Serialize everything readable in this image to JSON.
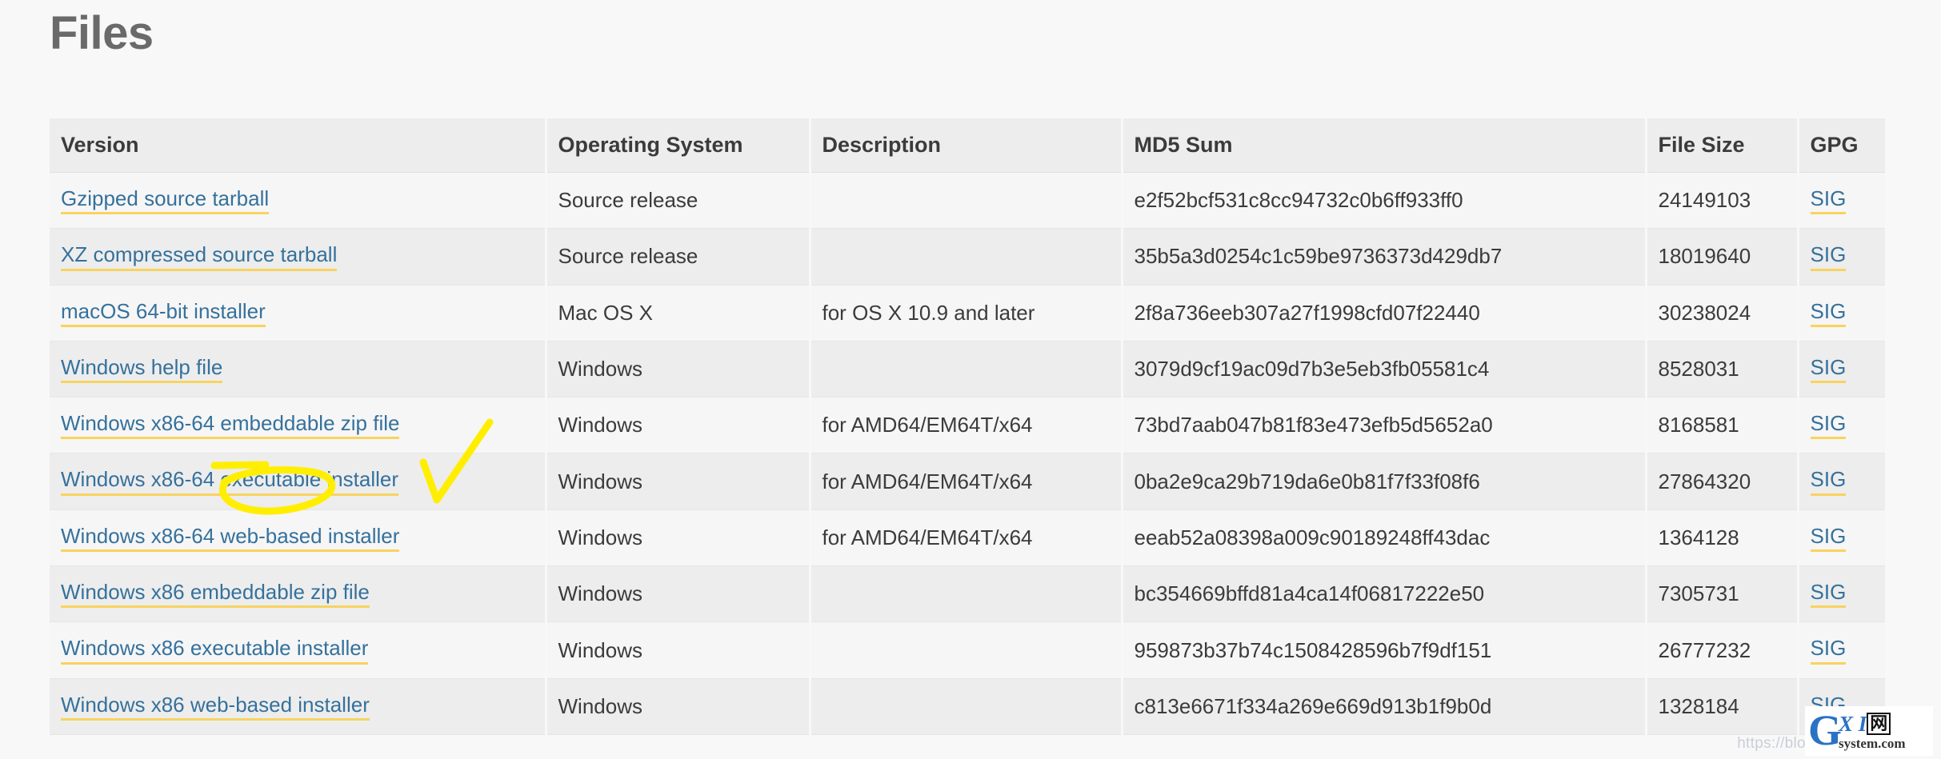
{
  "page": {
    "title": "Files"
  },
  "table": {
    "columns": [
      {
        "key": "version",
        "label": "Version"
      },
      {
        "key": "os",
        "label": "Operating System"
      },
      {
        "key": "description",
        "label": "Description"
      },
      {
        "key": "md5",
        "label": "MD5 Sum"
      },
      {
        "key": "size",
        "label": "File Size"
      },
      {
        "key": "gpg",
        "label": "GPG"
      }
    ],
    "rows": [
      {
        "version": "Gzipped source tarball",
        "os": "Source release",
        "description": "",
        "md5": "e2f52bcf531c8cc94732c0b6ff933ff0",
        "size": "24149103",
        "gpg": "SIG"
      },
      {
        "version": "XZ compressed source tarball",
        "os": "Source release",
        "description": "",
        "md5": "35b5a3d0254c1c59be9736373d429db7",
        "size": "18019640",
        "gpg": "SIG"
      },
      {
        "version": "macOS 64-bit installer",
        "os": "Mac OS X",
        "description": "for OS X 10.9 and later",
        "md5": "2f8a736eeb307a27f1998cfd07f22440",
        "size": "30238024",
        "gpg": "SIG"
      },
      {
        "version": "Windows help file",
        "os": "Windows",
        "description": "",
        "md5": "3079d9cf19ac09d7b3e5eb3fb05581c4",
        "size": "8528031",
        "gpg": "SIG"
      },
      {
        "version": "Windows x86-64 embeddable zip file",
        "os": "Windows",
        "description": "for AMD64/EM64T/x64",
        "md5": "73bd7aab047b81f83e473efb5d5652a0",
        "size": "8168581",
        "gpg": "SIG"
      },
      {
        "version": "Windows x86-64 executable installer",
        "os": "Windows",
        "description": "for AMD64/EM64T/x64",
        "md5": "0ba2e9ca29b719da6e0b81f7f33f08f6",
        "size": "27864320",
        "gpg": "SIG"
      },
      {
        "version": "Windows x86-64 web-based installer",
        "os": "Windows",
        "description": "for AMD64/EM64T/x64",
        "md5": "eeab52a08398a009c90189248ff43dac",
        "size": "1364128",
        "gpg": "SIG"
      },
      {
        "version": "Windows x86 embeddable zip file",
        "os": "Windows",
        "description": "",
        "md5": "bc354669bffd81a4ca14f06817222e50",
        "size": "7305731",
        "gpg": "SIG"
      },
      {
        "version": "Windows x86 executable installer",
        "os": "Windows",
        "description": "",
        "md5": "959873b37b74c1508428596b7f9df151",
        "size": "26777232",
        "gpg": "SIG"
      },
      {
        "version": "Windows x86 web-based installer",
        "os": "Windows",
        "description": "",
        "md5": "c813e6671f334a269e669d913b1f9b0d",
        "size": "1328184",
        "gpg": "SIG"
      }
    ]
  },
  "annotations": {
    "color": "#ffee00",
    "ellipse_target": "executable",
    "marks": [
      {
        "name": "highlight-ellipse",
        "shape": "ellipse"
      },
      {
        "name": "check-mark",
        "shape": "checkmark"
      }
    ]
  },
  "watermark": {
    "url": "https://blog.csdn.net/q",
    "logo_letter": "G",
    "logo_xi": "X I",
    "logo_cjk": "网",
    "logo_domain": "system.com"
  },
  "colors": {
    "link": "#35719c",
    "link_underline": "#f8d35f",
    "header_bg": "#ededed",
    "row_odd_bg": "#f6f6f6",
    "row_even_bg": "#ededed",
    "page_bg": "#f8f8f8",
    "title": "#6a6a6a",
    "annotation": "#ffee00"
  }
}
